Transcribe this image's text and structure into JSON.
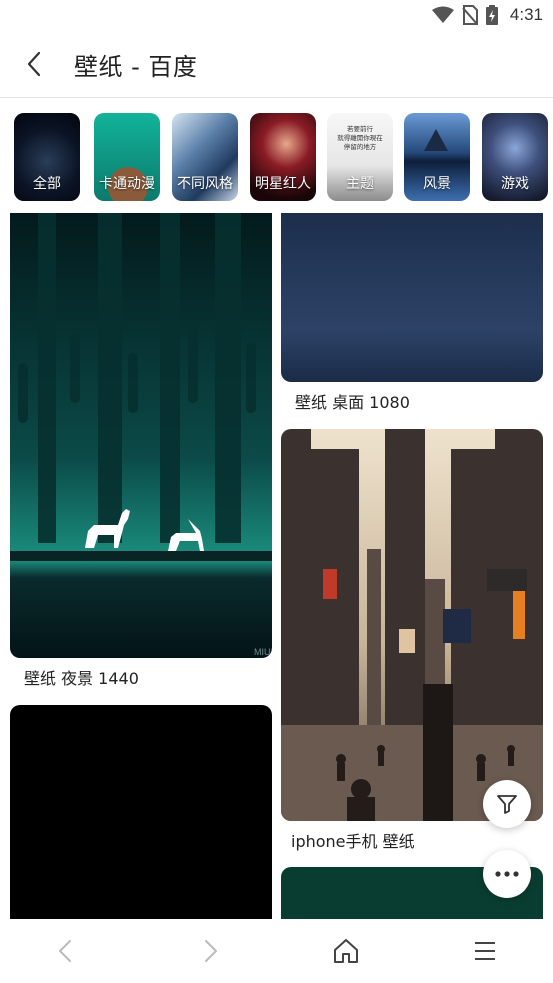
{
  "status_bar": {
    "time": "4:31",
    "icons": [
      "wifi-icon",
      "no-sim-icon",
      "battery-charging-icon"
    ]
  },
  "header": {
    "title": "壁纸 - 百度",
    "back_icon": "chevron-left-icon"
  },
  "categories": [
    {
      "label": "全部",
      "active": true,
      "colors": [
        "#0b1426",
        "#2a3d58"
      ]
    },
    {
      "label": "卡通动漫",
      "active": false,
      "colors": [
        "#10a08a",
        "#0c7a6c"
      ]
    },
    {
      "label": "不同风格",
      "active": false,
      "colors": [
        "#bfd4e8",
        "#3c5f86"
      ]
    },
    {
      "label": "明星红人",
      "active": false,
      "colors": [
        "#2a0c10",
        "#8a1b25"
      ]
    },
    {
      "label": "主题",
      "active": false,
      "colors": [
        "#f4f4f4",
        "#9a9a9a"
      ]
    },
    {
      "label": "风景",
      "active": false,
      "colors": [
        "#3d6fb0",
        "#0d1e3a"
      ]
    },
    {
      "label": "游戏",
      "active": false,
      "colors": [
        "#1a2338",
        "#5c74a6"
      ]
    }
  ],
  "theme_thumb_text": "若要前行\n就得離開你現在\n停留的地方",
  "feed": {
    "left": [
      {
        "caption": "壁纸 夜景 1440",
        "watermark": "MIUI"
      },
      {
        "caption": ""
      }
    ],
    "right": [
      {
        "caption": "壁纸 桌面 1080"
      },
      {
        "caption": "iphone手机 壁纸"
      },
      {
        "caption": ""
      }
    ]
  },
  "fabs": {
    "filter_icon": "filter-icon",
    "more_icon": "more-horizontal-icon"
  },
  "bottom_nav": [
    "back-arrow-icon",
    "forward-arrow-icon",
    "home-icon",
    "menu-icon"
  ],
  "colors": {
    "accent": "#4a6cf7",
    "divider": "#e6e6e6",
    "icon": "#555555"
  }
}
